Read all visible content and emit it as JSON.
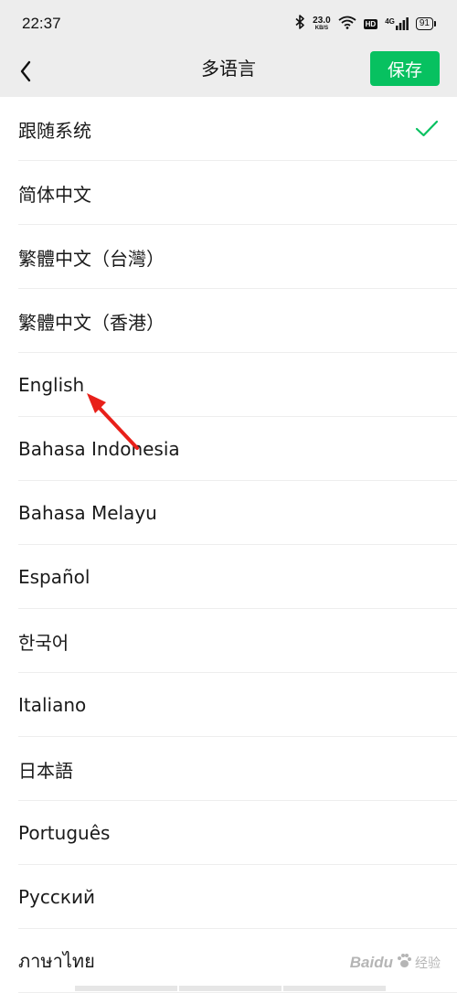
{
  "status_bar": {
    "time": "22:37",
    "net_speed_value": "23.0",
    "net_speed_unit": "KB/S",
    "hd_label": "HD",
    "signal_label": "4G",
    "battery": "91",
    "icons": [
      "bluetooth-icon",
      "wifi-icon",
      "hd-icon",
      "signal-icon",
      "battery-icon"
    ]
  },
  "nav": {
    "title": "多语言",
    "save_label": "保存",
    "back_icon": "chevron-left-icon",
    "accent_color": "#07c160"
  },
  "languages": [
    {
      "label": "跟随系统",
      "selected": true
    },
    {
      "label": "简体中文",
      "selected": false
    },
    {
      "label": "繁體中文（台灣）",
      "selected": false
    },
    {
      "label": "繁體中文（香港）",
      "selected": false
    },
    {
      "label": "English",
      "selected": false
    },
    {
      "label": "Bahasa Indonesia",
      "selected": false
    },
    {
      "label": "Bahasa Melayu",
      "selected": false
    },
    {
      "label": "Español",
      "selected": false
    },
    {
      "label": "한국어",
      "selected": false
    },
    {
      "label": "Italiano",
      "selected": false
    },
    {
      "label": "日本語",
      "selected": false
    },
    {
      "label": "Português",
      "selected": false
    },
    {
      "label": "Русский",
      "selected": false
    },
    {
      "label": "ภาษาไทย",
      "selected": false
    }
  ],
  "watermark": {
    "text": "Baidu",
    "sub": "经验"
  }
}
